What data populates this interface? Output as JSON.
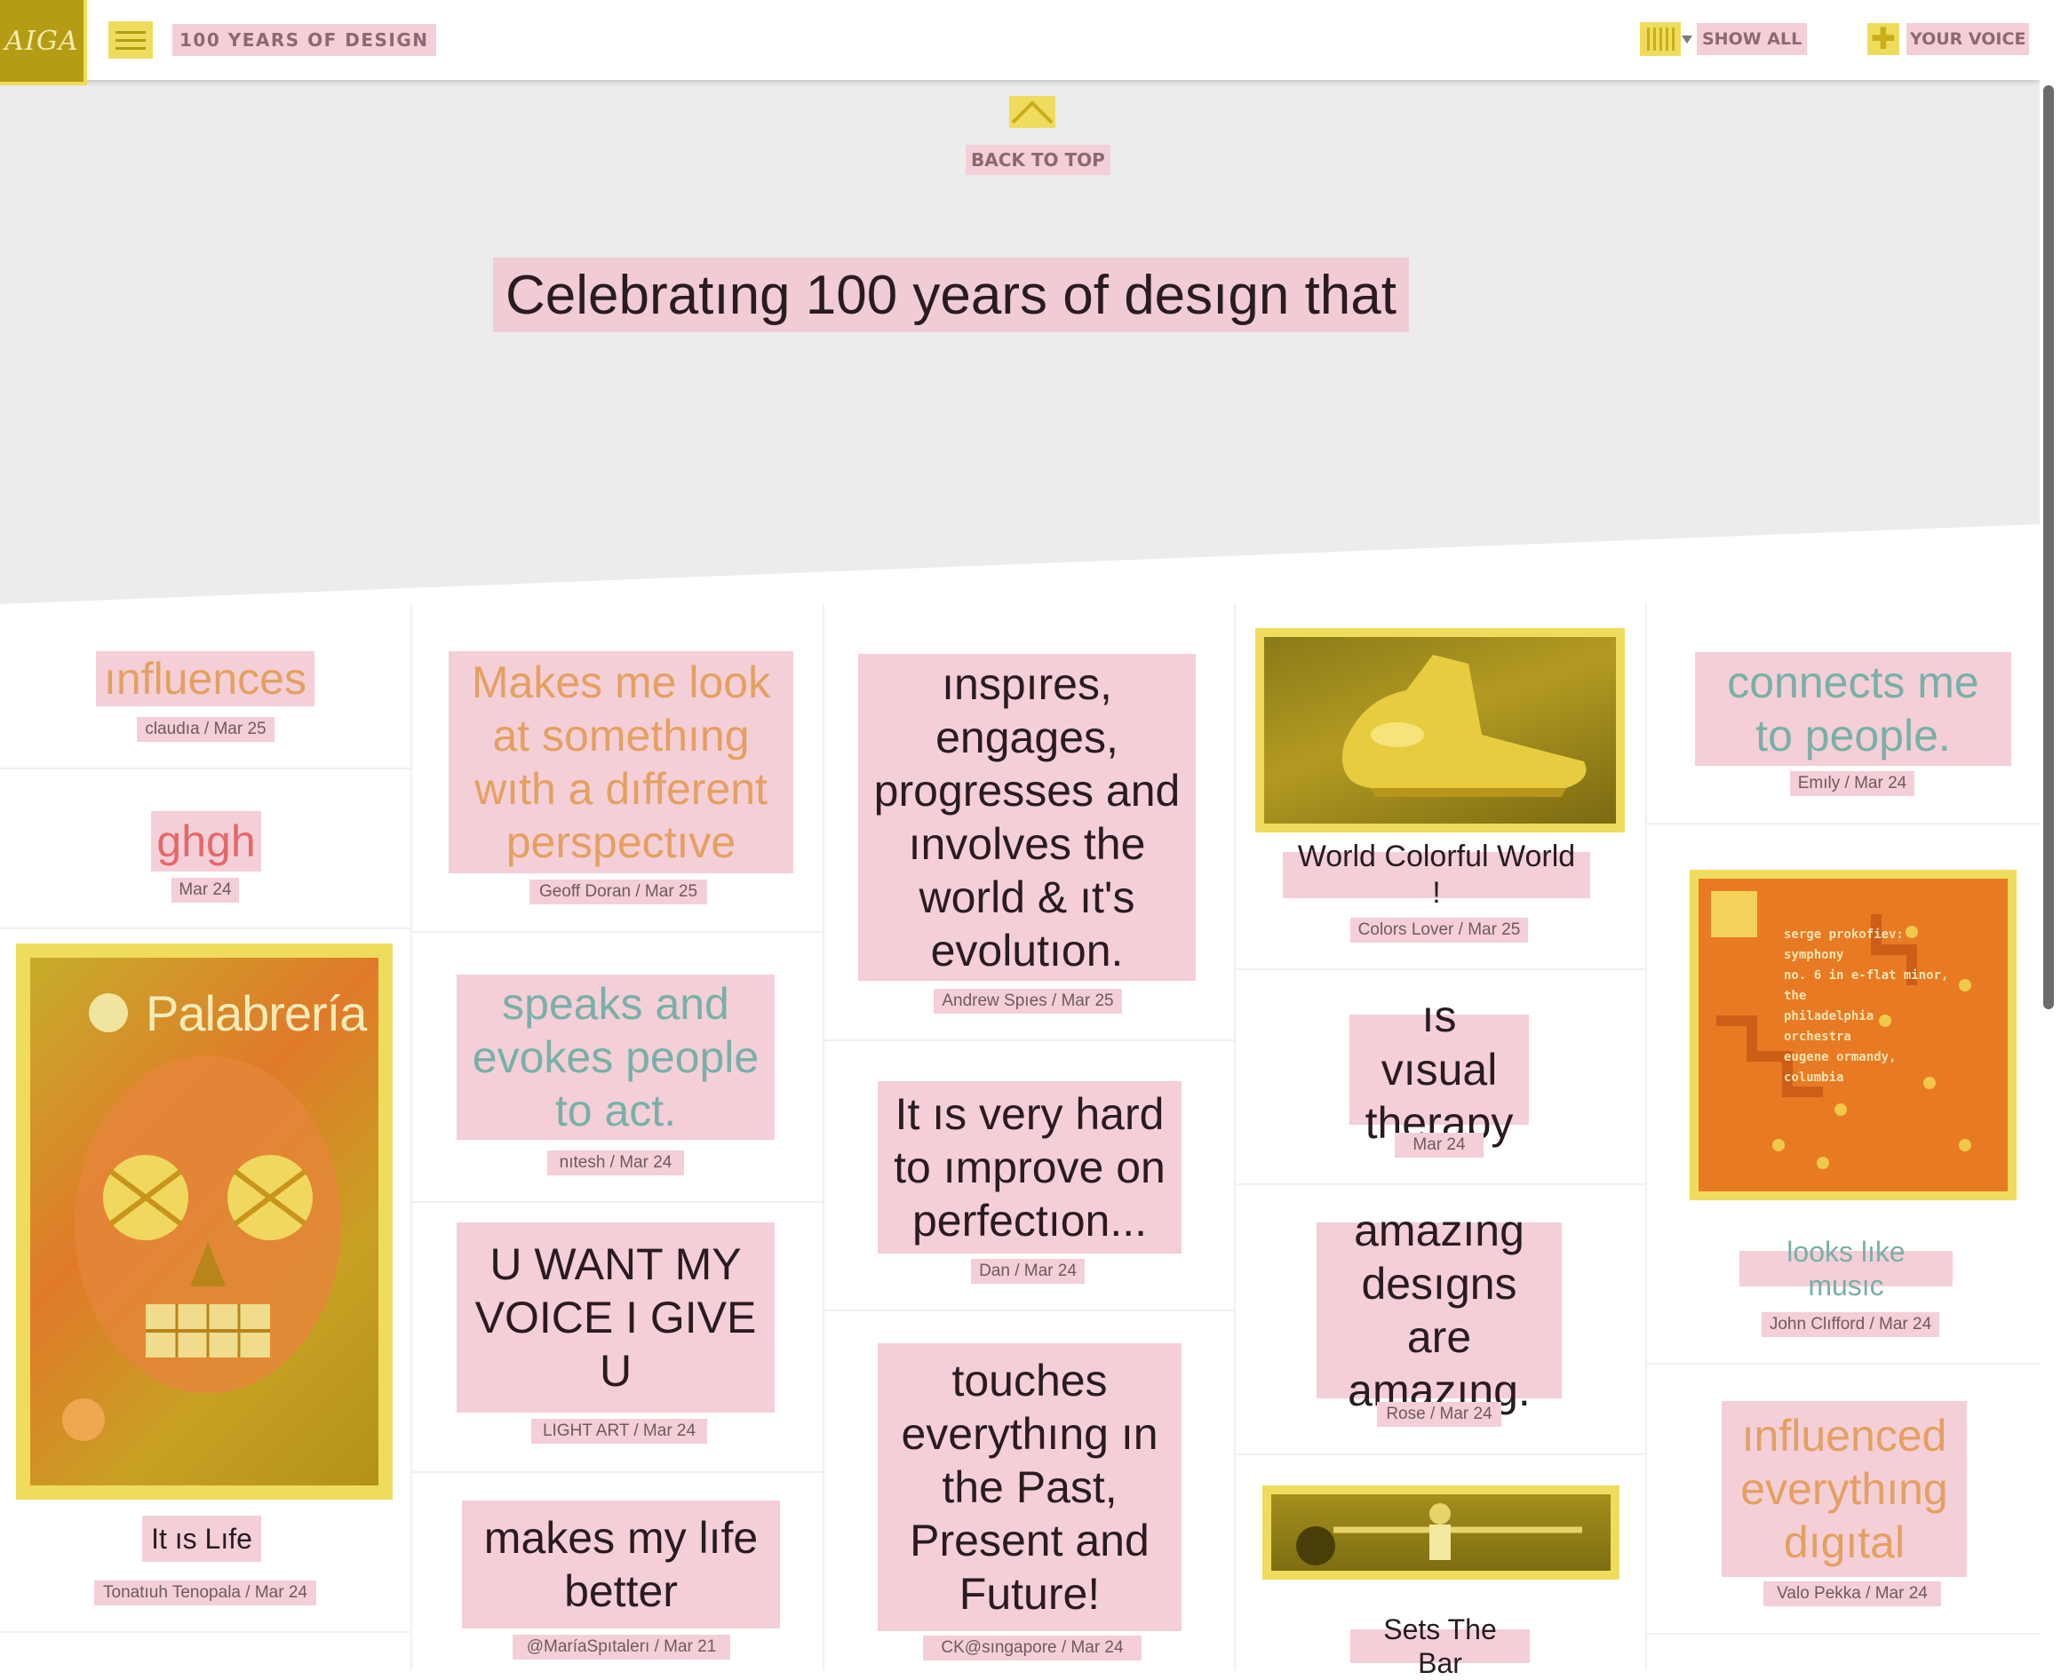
{
  "header": {
    "logo_text": "AIGA",
    "site_title": "100 YEARS OF DESIGN",
    "show_all_label": "SHOW ALL",
    "your_voice_label": "YOUR VOICE"
  },
  "hero": {
    "back_to_top": "BACK TO TOP",
    "headline": "Celebratıng 100 years of desıgn that"
  },
  "colors": {
    "accent_yellow": "#f0dc5c",
    "label_pink": "#f4cfd8",
    "hero_gray": "#ececec",
    "orange_text": "#e4a060",
    "teal_text": "#78b0a8",
    "coral_text": "#e46868",
    "dark_text": "#2a1b22"
  },
  "cards": {
    "c1_quote": "ınfluences",
    "c1_meta": "claudıa / Mar 25",
    "c2_quote": "ghgh",
    "c2_meta": "Mar 24",
    "c3_image_text": "Palabrería",
    "c3_caption": "It ıs Lıfe",
    "c3_meta": "Tonatıuh Tenopala / Mar 24",
    "c4_quote": "Makes me look at somethıng wıth a dıfferent perspectıve",
    "c4_meta": "Geoff Doran / Mar 25",
    "c5_quote": "speaks and evokes people to act.",
    "c5_meta": "nıtesh / Mar 24",
    "c6_quote": "U WANT MY VOICE I GIVE U",
    "c6_meta": "LIGHT ART / Mar 24",
    "c7_quote": "makes my lıfe better",
    "c7_meta": "@MaríaSpıtalerı / Mar 21",
    "c8_quote": "ınspıres, engages, progresses and ınvolves the world & ıt's evolutıon.",
    "c8_meta": "Andrew Spıes / Mar 25",
    "c9_quote": "It ıs very hard to ımprove on perfectıon...",
    "c9_meta": "Dan / Mar 24",
    "c10_quote": "touches everythıng ın the Past, Present and Future!",
    "c10_meta": "CK@sıngapore / Mar 24",
    "c11_caption": "World Colorful World !",
    "c11_meta": "Colors Lover / Mar 25",
    "c12_quote": "ıs vısual therapy",
    "c12_meta": "Mar 24",
    "c13_quote": "amazıng desıgns are amazıng.",
    "c13_meta": "Rose / Mar 24",
    "c14_caption": "Sets The Bar",
    "c15_quote": "connects me to people.",
    "c15_meta": "Emıly / Mar 24",
    "c16_album_lines": [
      "serge prokofiev:",
      "symphony",
      "no. 6 in e-flat minor,",
      "the",
      "philadelphia",
      "orchestra",
      "eugene ormandy,",
      "columbia"
    ],
    "c16_caption": "looks lıke musıc",
    "c16_meta": "John Clıfford / Mar 24",
    "c17_quote": "ınfluenced everythıng dıgıtal",
    "c17_meta": "Valo Pekka / Mar 24"
  }
}
